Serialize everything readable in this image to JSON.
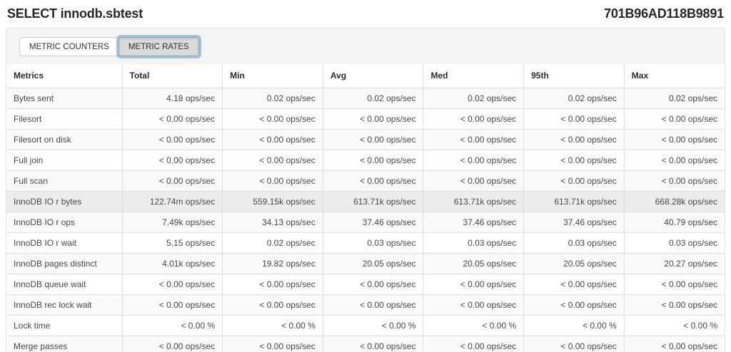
{
  "page": {
    "title": "SELECT innodb.sbtest",
    "query_id": "701B96AD118B9891"
  },
  "tabs": [
    {
      "label": "METRIC COUNTERS",
      "active": false
    },
    {
      "label": "METRIC RATES",
      "active": true
    }
  ],
  "table": {
    "columns": [
      "Metrics",
      "Total",
      "Min",
      "Avg",
      "Med",
      "95th",
      "Max"
    ],
    "rows": [
      {
        "metric": "Bytes sent",
        "values": [
          "4.18 ops/sec",
          "0.02 ops/sec",
          "0.02 ops/sec",
          "0.02 ops/sec",
          "0.02 ops/sec",
          "0.02 ops/sec"
        ]
      },
      {
        "metric": "Filesort",
        "values": [
          "< 0.00 ops/sec",
          "< 0.00 ops/sec",
          "< 0.00 ops/sec",
          "< 0.00 ops/sec",
          "< 0.00 ops/sec",
          "< 0.00 ops/sec"
        ]
      },
      {
        "metric": "Filesort on disk",
        "values": [
          "< 0.00 ops/sec",
          "< 0.00 ops/sec",
          "< 0.00 ops/sec",
          "< 0.00 ops/sec",
          "< 0.00 ops/sec",
          "< 0.00 ops/sec"
        ]
      },
      {
        "metric": "Full join",
        "values": [
          "< 0.00 ops/sec",
          "< 0.00 ops/sec",
          "< 0.00 ops/sec",
          "< 0.00 ops/sec",
          "< 0.00 ops/sec",
          "< 0.00 ops/sec"
        ]
      },
      {
        "metric": "Full scan",
        "values": [
          "< 0.00 ops/sec",
          "< 0.00 ops/sec",
          "< 0.00 ops/sec",
          "< 0.00 ops/sec",
          "< 0.00 ops/sec",
          "< 0.00 ops/sec"
        ]
      },
      {
        "metric": "InnoDB IO r bytes",
        "values": [
          "122.74m ops/sec",
          "559.15k ops/sec",
          "613.71k ops/sec",
          "613.71k ops/sec",
          "613.71k ops/sec",
          "668.28k ops/sec"
        ],
        "highlighted": true
      },
      {
        "metric": "InnoDB IO r ops",
        "values": [
          "7.49k ops/sec",
          "34.13 ops/sec",
          "37.46 ops/sec",
          "37.46 ops/sec",
          "37.46 ops/sec",
          "40.79 ops/sec"
        ]
      },
      {
        "metric": "InnoDB IO r wait",
        "values": [
          "5.15 ops/sec",
          "0.02 ops/sec",
          "0.03 ops/sec",
          "0.03 ops/sec",
          "0.03 ops/sec",
          "0.03 ops/sec"
        ]
      },
      {
        "metric": "InnoDB pages distinct",
        "values": [
          "4.01k ops/sec",
          "19.82 ops/sec",
          "20.05 ops/sec",
          "20.05 ops/sec",
          "20.05 ops/sec",
          "20.27 ops/sec"
        ]
      },
      {
        "metric": "InnoDB queue wait",
        "values": [
          "< 0.00 ops/sec",
          "< 0.00 ops/sec",
          "< 0.00 ops/sec",
          "< 0.00 ops/sec",
          "< 0.00 ops/sec",
          "< 0.00 ops/sec"
        ]
      },
      {
        "metric": "InnoDB rec lock wait",
        "values": [
          "< 0.00 ops/sec",
          "< 0.00 ops/sec",
          "< 0.00 ops/sec",
          "< 0.00 ops/sec",
          "< 0.00 ops/sec",
          "< 0.00 ops/sec"
        ]
      },
      {
        "metric": "Lock time",
        "values": [
          "< 0.00 %",
          "< 0.00 %",
          "< 0.00 %",
          "< 0.00 %",
          "< 0.00 %",
          "< 0.00 %"
        ]
      },
      {
        "metric": "Merge passes",
        "values": [
          "< 0.00 ops/sec",
          "< 0.00 ops/sec",
          "< 0.00 ops/sec",
          "< 0.00 ops/sec",
          "< 0.00 ops/sec",
          "< 0.00 ops/sec"
        ]
      }
    ]
  },
  "colors": {
    "stripe": "#f9f9f9",
    "row_highlight": "#ececec",
    "panel_bg": "#f4f4f4",
    "table_border": "#dddddd",
    "active_tab_bg": "#d9d9d9",
    "focus_ring": "#7db4e6"
  }
}
